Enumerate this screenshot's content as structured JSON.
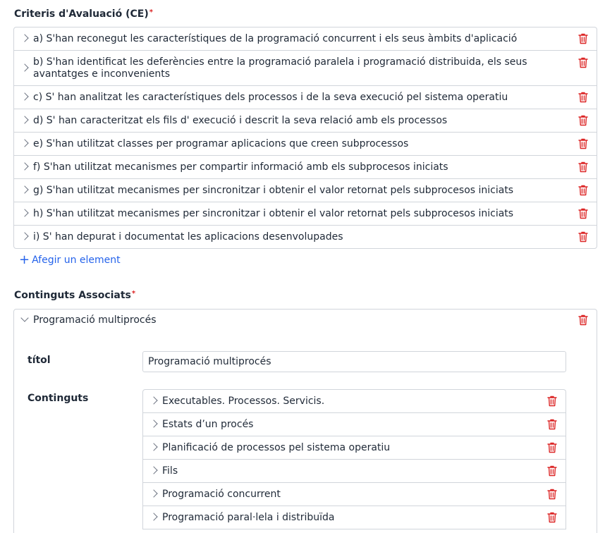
{
  "criteris": {
    "label": "Criteris d'Avaluació (CE)",
    "required_mark": "*",
    "items": [
      {
        "label": "a) S'han reconegut les característiques de la programació concurrent i els seus àmbits d'aplicació"
      },
      {
        "label": "b) S'han identificat les deferències entre la programació paralela i programació distribuida, els seus avantatges e inconvenients"
      },
      {
        "label": "c) S' han analitzat les característiques dels processos i de la seva execució pel sistema operatiu"
      },
      {
        "label": "d) S' han caracteritzat els fils d' execució i descrit la seva relació amb els processos"
      },
      {
        "label": "e) S'han utilitzat classes per programar aplicacions que creen subprocessos"
      },
      {
        "label": "f) S'han utilitzat mecanismes per compartir informació amb els subprocesos iniciats"
      },
      {
        "label": "g) S'han utilitzat mecanismes per sincronitzar i obtenir el valor retornat pels subprocesos iniciats"
      },
      {
        "label": "h) S'han utilitzat mecanismes per sincronitzar i obtenir el valor retornat pels subprocesos iniciats"
      },
      {
        "label": "i) S' han depurat i documentat les aplicacions desenvolupades"
      }
    ],
    "add_label": "Afegir un element"
  },
  "continguts_associats": {
    "label": "Continguts Associats",
    "required_mark": "*",
    "item": {
      "header": "Programació multiprocés",
      "titol_label": "títol",
      "titol_value": "Programació multiprocés",
      "continguts_label": "Continguts",
      "continguts": [
        {
          "label": "Executables. Processos. Servicis."
        },
        {
          "label": "Estats d’un procés"
        },
        {
          "label": "Planificació de processos pel sistema operatiu"
        },
        {
          "label": "Fils"
        },
        {
          "label": "Programació concurrent"
        },
        {
          "label": "Programació paral·lela i distribuïda"
        }
      ]
    }
  },
  "colors": {
    "accent": "#2563eb",
    "danger": "#dc2626",
    "border": "#d1d5db"
  }
}
